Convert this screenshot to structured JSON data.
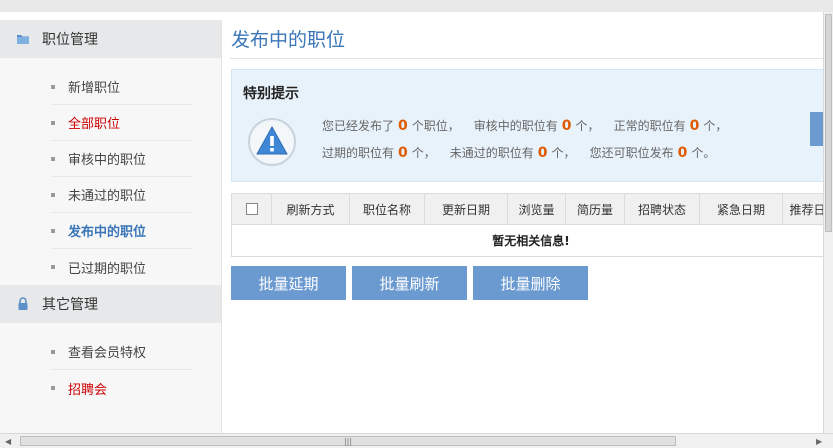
{
  "sidebar": {
    "sections": [
      {
        "title": "职位管理",
        "icon": "folder-icon",
        "items": [
          {
            "label": "新增职位",
            "state": "normal"
          },
          {
            "label": "全部职位",
            "state": "red"
          },
          {
            "label": "审核中的职位",
            "state": "normal"
          },
          {
            "label": "未通过的职位",
            "state": "normal"
          },
          {
            "label": "发布中的职位",
            "state": "active"
          },
          {
            "label": "已过期的职位",
            "state": "normal"
          }
        ]
      },
      {
        "title": "其它管理",
        "icon": "lock-icon",
        "items": [
          {
            "label": "查看会员特权",
            "state": "normal"
          },
          {
            "label": "招聘会",
            "state": "red"
          }
        ]
      }
    ]
  },
  "main": {
    "title": "发布中的职位",
    "notice": {
      "title": "特别提示",
      "icon": "warning-icon",
      "line1": {
        "p1": "您已经发布了",
        "n1": "0",
        "p2": "个职位，",
        "p3": "审核中的职位有",
        "n2": "0",
        "p4": "个，",
        "p5": "正常的职位有",
        "n3": "0",
        "p6": "个，"
      },
      "line2": {
        "p1": "过期的职位有",
        "n1": "0",
        "p2": "个，",
        "p3": "未通过的职位有",
        "n2": "0",
        "p4": "个，",
        "p5": "您还可职位发布",
        "n3": "0",
        "p6": "个。"
      }
    },
    "table": {
      "columns": [
        "刷新方式",
        "职位名称",
        "更新日期",
        "浏览量",
        "简历量",
        "招聘状态",
        "紧急日期",
        "推荐日"
      ],
      "empty_message": "暂无相关信息!"
    },
    "actions": {
      "extend": "批量延期",
      "refresh": "批量刷新",
      "delete": "批量删除"
    }
  },
  "colors": {
    "accent": "#3a76b8",
    "button": "#6a9ad0",
    "highlight_number": "#e05a00",
    "red_link": "#cc0000"
  }
}
